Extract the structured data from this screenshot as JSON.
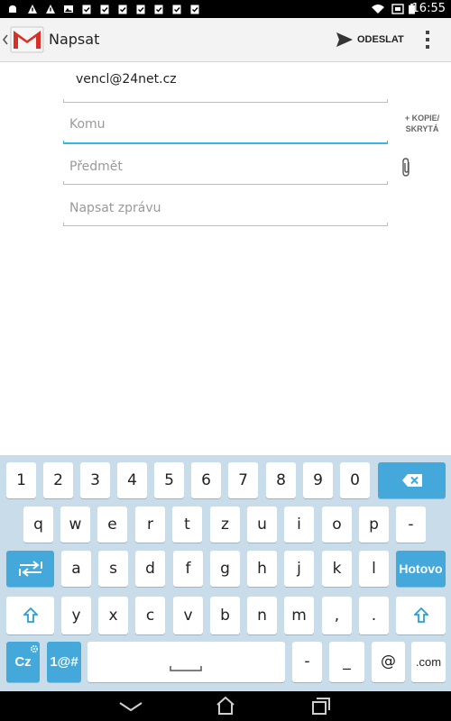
{
  "status_bar": {
    "time": "16:55",
    "icons": [
      "notification-android-icon",
      "warning-icon",
      "warning-icon",
      "image-icon",
      "clipboard-icon",
      "clipboard-icon",
      "clipboard-icon",
      "clipboard-icon",
      "clipboard-icon",
      "clipboard-icon",
      "clipboard-icon",
      "wifi-icon",
      "screenshot-icon",
      "battery-icon"
    ]
  },
  "action_bar": {
    "title": "Napsat",
    "send_label": "ODESLAT"
  },
  "compose": {
    "from": "vencl@24net.cz",
    "to_placeholder": "Komu",
    "cc_bcc_label_line1": "+ KOPIE/",
    "cc_bcc_label_line2": "SKRYTÁ",
    "subject_placeholder": "Předmět",
    "body_placeholder": "Napsat zprávu"
  },
  "keyboard": {
    "row1": [
      "1",
      "2",
      "3",
      "4",
      "5",
      "6",
      "7",
      "8",
      "9",
      "0"
    ],
    "row2": [
      "q",
      "w",
      "e",
      "r",
      "t",
      "z",
      "u",
      "i",
      "o",
      "p",
      "-"
    ],
    "row3": [
      "a",
      "s",
      "d",
      "f",
      "g",
      "h",
      "j",
      "k",
      "l"
    ],
    "row3_action": "Hotovo",
    "row4": [
      "y",
      "x",
      "c",
      "v",
      "b",
      "n",
      "m",
      ",",
      "."
    ],
    "row5_lang": "Cz",
    "row5_symbols": "1@#",
    "row5_dash": "-",
    "row5_underscore": "_",
    "row5_at": "@",
    "row5_com": ".com"
  },
  "colors": {
    "accent": "#33b5e5",
    "keyboard_bg": "#c8dce9",
    "key_blue": "#44a8da"
  }
}
